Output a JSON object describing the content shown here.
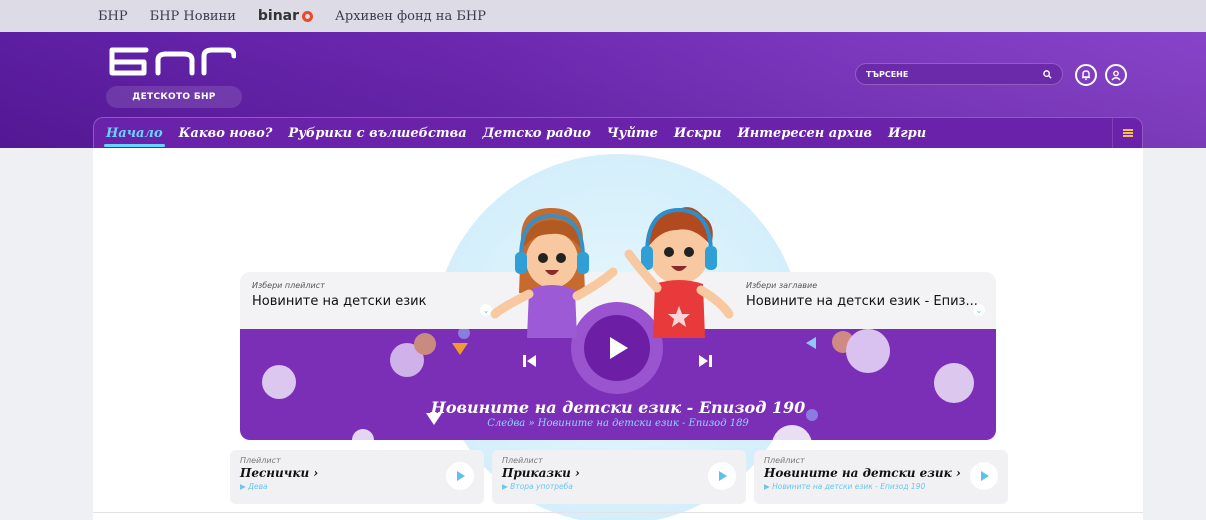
{
  "topbar": {
    "links": [
      "БНР",
      "БНР Новини",
      "binar",
      "Архивен фонд на БНР"
    ]
  },
  "header": {
    "logo_text": "ДЕТСКОТО БНР",
    "search_placeholder": "ТЪРСЕНЕ"
  },
  "nav": {
    "items": [
      "Начало",
      "Какво ново?",
      "Рубрики с вълшебства",
      "Детско радио",
      "Чуйте",
      "Искри",
      "Интересен архив",
      "Игри"
    ],
    "active": "Начало"
  },
  "player": {
    "playlist_label": "Избери плейлист",
    "playlist_value": "Новините на детски език",
    "title_label": "Избери заглавие",
    "title_value": "Новините на детски език - Епиз...",
    "now_playing": "Новините на детски език - Епизод 190",
    "next_prefix": "Следва",
    "next_track": "Новините на детски език - Епизод 189"
  },
  "cards": [
    {
      "label": "Плейлист",
      "title": "Песнички",
      "subtitle": "Дева"
    },
    {
      "label": "Плейлист",
      "title": "Приказки",
      "subtitle": "Втора употреба"
    },
    {
      "label": "Плейлист",
      "title": "Новините на детски език",
      "subtitle": "Новините на детски език - Епизод 190"
    }
  ],
  "colors": {
    "header": "#6a25b0",
    "player": "#7b2fb6",
    "accent_blue": "#68d4ff",
    "menu_icon": "#f5c04a"
  }
}
